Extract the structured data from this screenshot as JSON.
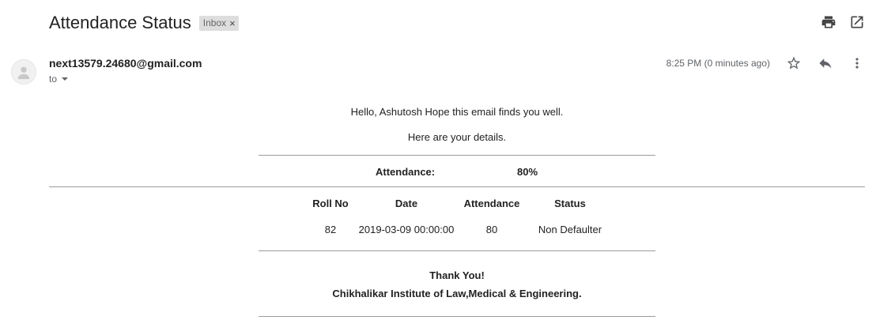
{
  "email": {
    "subject": "Attendance Status",
    "label": "Inbox",
    "label_remove": "×",
    "sender": "next13579.24680@gmail.com",
    "to_label": "to",
    "timestamp": "8:25 PM (0 minutes ago)",
    "icons": {
      "print": "print-icon",
      "open_new_window": "open-in-new-window-icon",
      "star": "star-icon",
      "reply": "reply-icon",
      "more": "more-vertical-icon",
      "avatar": "avatar-person-icon"
    }
  },
  "message": {
    "greeting": "Hello, Ashutosh Hope this email finds you well.",
    "details_line": "Here are your details.",
    "attendance_label": "Attendance:",
    "attendance_value": "80%",
    "table": {
      "headers": [
        "Roll No",
        "Date",
        "Attendance",
        "Status"
      ],
      "rows": [
        [
          "82",
          "2019-03-09 00:00:00",
          "80",
          "Non Defaulter"
        ]
      ]
    },
    "thanks": "Thank You!",
    "institute": "Chikhalikar Institute of Law,Medical & Engineering."
  }
}
